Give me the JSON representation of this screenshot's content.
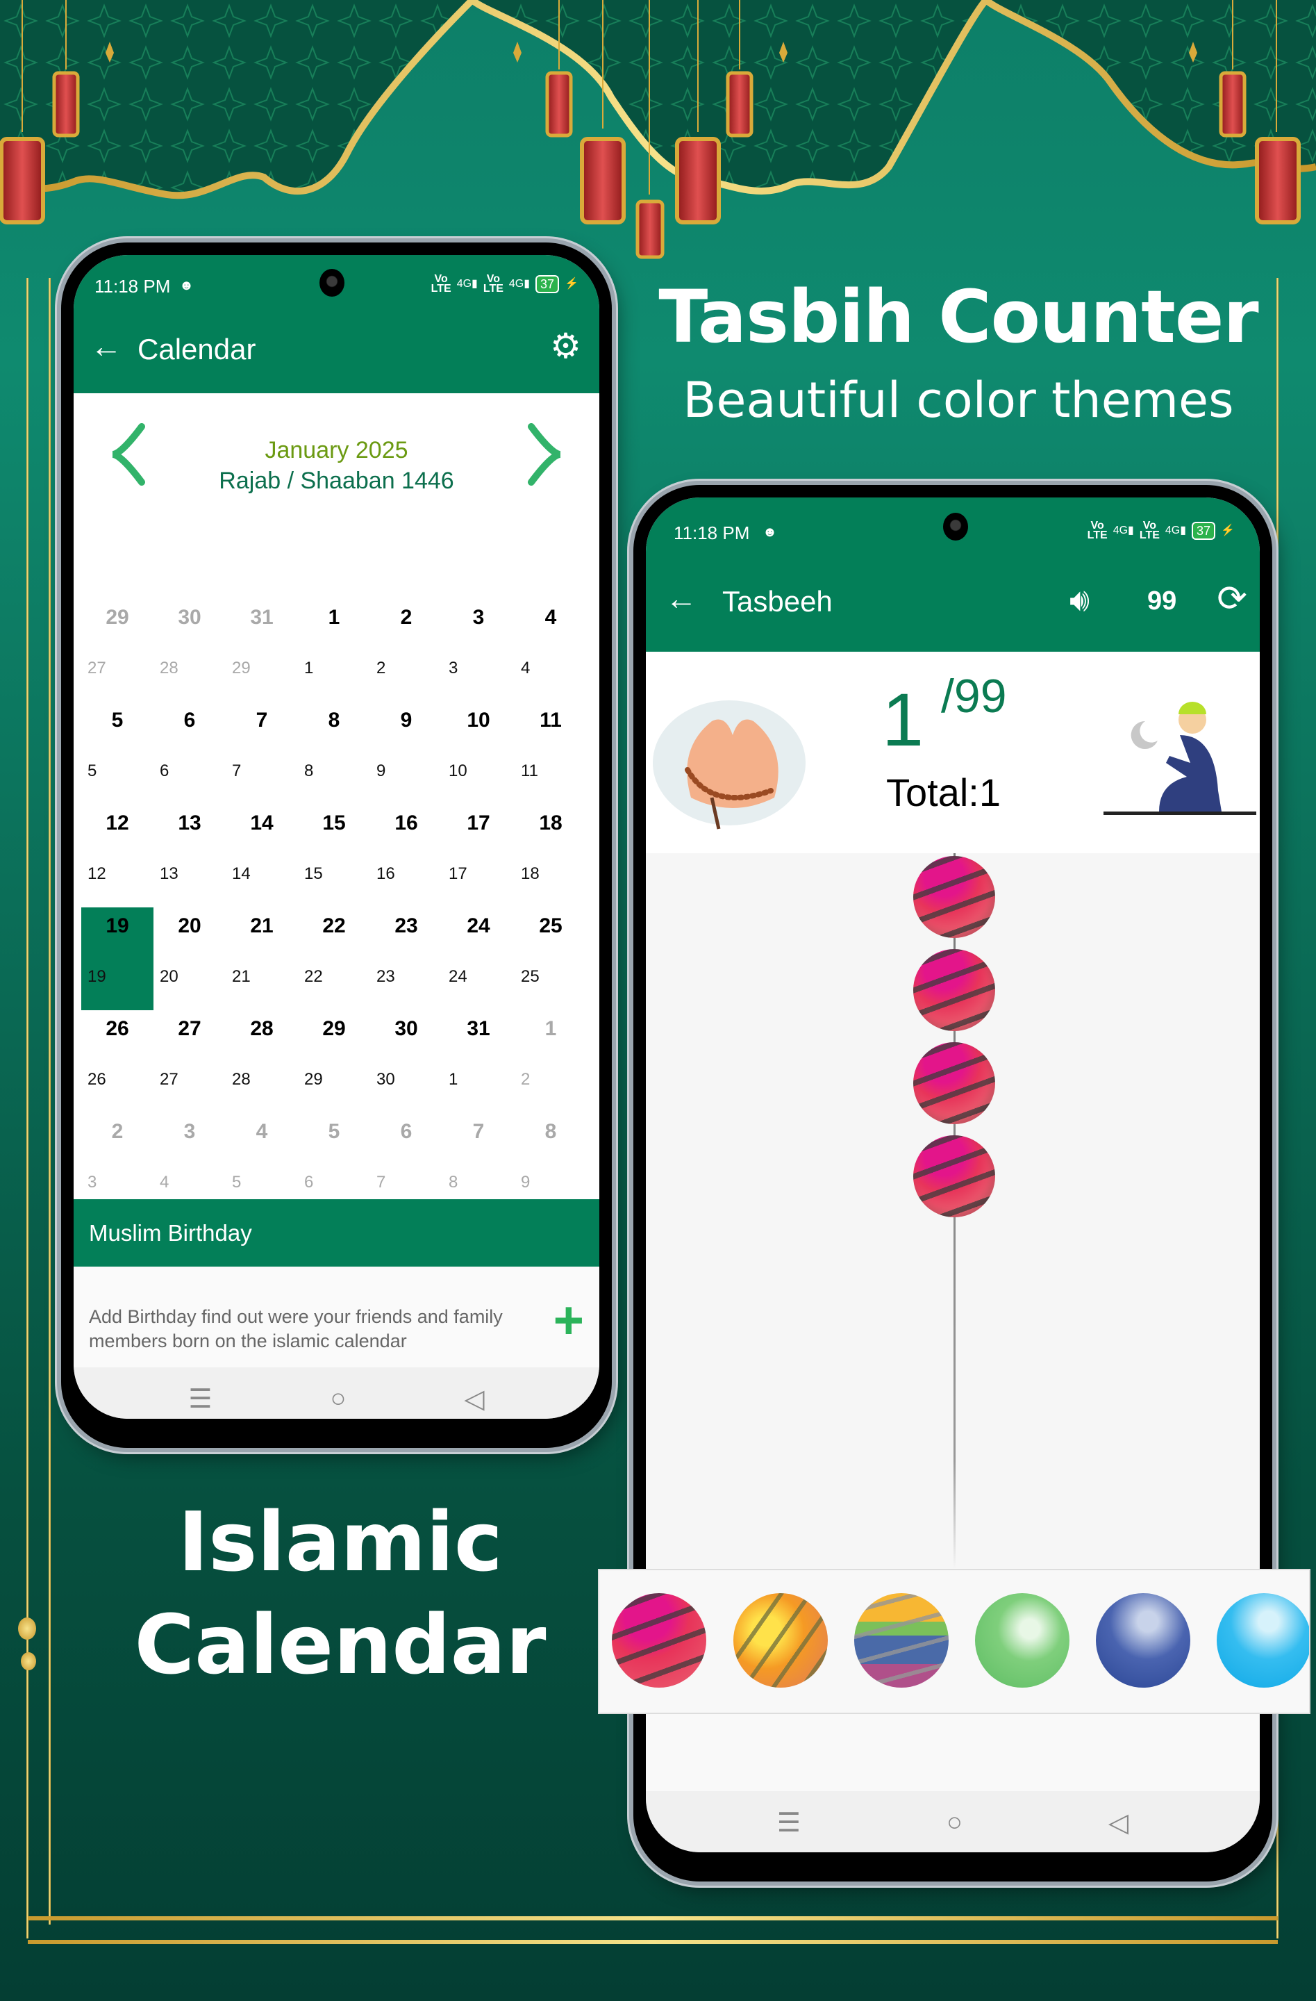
{
  "promo": {
    "tasbih_title": "Tasbih Counter",
    "tasbih_subtitle": "Beautiful color themes",
    "calendar_title_line1": "Islamic",
    "calendar_title_line2": "Calendar"
  },
  "status_bar": {
    "time": "11:18 PM",
    "network_1": "Vo LTE 4G",
    "network_2": "Vo LTE 4G",
    "battery": "37"
  },
  "calendar_screen": {
    "appbar": {
      "title": "Calendar",
      "back_icon": "arrow-left-icon",
      "settings_icon": "gear-icon"
    },
    "month_label": "January 2025",
    "hijri_label": "Rajab / Shaaban 1446",
    "prev_icon": "chevron-left-icon",
    "next_icon": "chevron-right-icon",
    "selected_day": "19",
    "weeks": [
      [
        {
          "g": "29",
          "h": "27",
          "dim": true
        },
        {
          "g": "30",
          "h": "28",
          "dim": true
        },
        {
          "g": "31",
          "h": "29",
          "dim": true
        },
        {
          "g": "1",
          "h": "1"
        },
        {
          "g": "2",
          "h": "2"
        },
        {
          "g": "3",
          "h": "3"
        },
        {
          "g": "4",
          "h": "4"
        }
      ],
      [
        {
          "g": "5",
          "h": "5"
        },
        {
          "g": "6",
          "h": "6"
        },
        {
          "g": "7",
          "h": "7"
        },
        {
          "g": "8",
          "h": "8"
        },
        {
          "g": "9",
          "h": "9"
        },
        {
          "g": "10",
          "h": "10"
        },
        {
          "g": "11",
          "h": "11"
        }
      ],
      [
        {
          "g": "12",
          "h": "12"
        },
        {
          "g": "13",
          "h": "13"
        },
        {
          "g": "14",
          "h": "14"
        },
        {
          "g": "15",
          "h": "15"
        },
        {
          "g": "16",
          "h": "16"
        },
        {
          "g": "17",
          "h": "17"
        },
        {
          "g": "18",
          "h": "18"
        }
      ],
      [
        {
          "g": "19",
          "h": "19",
          "selected": true
        },
        {
          "g": "20",
          "h": "20"
        },
        {
          "g": "21",
          "h": "21"
        },
        {
          "g": "22",
          "h": "22"
        },
        {
          "g": "23",
          "h": "23"
        },
        {
          "g": "24",
          "h": "24"
        },
        {
          "g": "25",
          "h": "25"
        }
      ],
      [
        {
          "g": "26",
          "h": "26"
        },
        {
          "g": "27",
          "h": "27"
        },
        {
          "g": "28",
          "h": "28"
        },
        {
          "g": "29",
          "h": "29"
        },
        {
          "g": "30",
          "h": "30"
        },
        {
          "g": "31",
          "h": "1"
        },
        {
          "g": "1",
          "h": "2",
          "dim": true
        }
      ],
      [
        {
          "g": "2",
          "h": "3",
          "dim": true
        },
        {
          "g": "3",
          "h": "4",
          "dim": true
        },
        {
          "g": "4",
          "h": "5",
          "dim": true
        },
        {
          "g": "5",
          "h": "6",
          "dim": true
        },
        {
          "g": "6",
          "h": "7",
          "dim": true
        },
        {
          "g": "7",
          "h": "8",
          "dim": true
        },
        {
          "g": "8",
          "h": "9",
          "dim": true
        }
      ]
    ],
    "birthday_section": {
      "title": "Muslim Birthday",
      "description": "Add Birthday find out were your friends and family members born on the islamic calendar",
      "add_icon": "plus-icon"
    }
  },
  "tasbeeh_screen": {
    "appbar": {
      "title": "Tasbeeh",
      "sound_icon": "speaker-icon",
      "target": "99",
      "reset_icon": "refresh-icon"
    },
    "count": "1",
    "target": "/99",
    "total": "Total:1",
    "beads_visible": 4,
    "palette": [
      {
        "name": "red-striped"
      },
      {
        "name": "orange-striped"
      },
      {
        "name": "multicolor-striped"
      },
      {
        "name": "green"
      },
      {
        "name": "blue"
      },
      {
        "name": "light-blue"
      }
    ]
  },
  "navbar": {
    "menu": "☰",
    "home": "○",
    "back": "◁"
  },
  "colors": {
    "primary": "#037f58",
    "accent_green": "#32b36a",
    "month_label": "#6b9a12",
    "gold": "#d4a838",
    "background": "#0b6e58"
  }
}
